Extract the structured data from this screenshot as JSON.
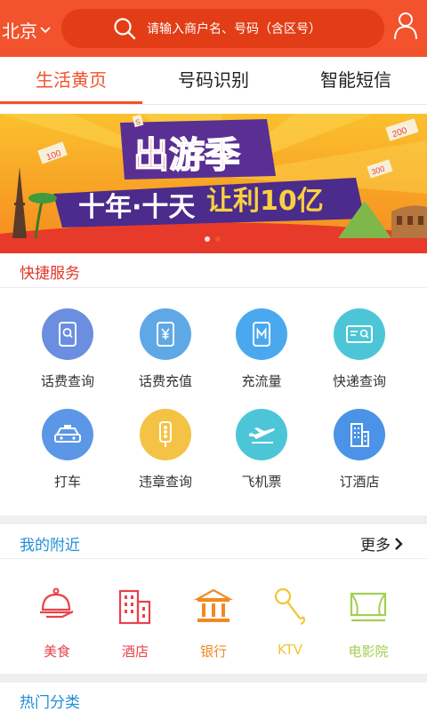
{
  "header": {
    "city": "北京",
    "search_placeholder": "请输入商户名、号码（含区号）"
  },
  "tabs": [
    {
      "label": "生活黄页",
      "active": true
    },
    {
      "label": "号码识别",
      "active": false
    },
    {
      "label": "智能短信",
      "active": false
    }
  ],
  "banner": {
    "title": "出游季",
    "line1": "十年·十天",
    "line2": "让利10亿",
    "tag_100": "100",
    "tag_200": "200",
    "tag_300": "300",
    "tag_s": "S",
    "slides": 2,
    "active_slide": 2
  },
  "quick": {
    "title": "快捷服务",
    "items": [
      {
        "label": "话费查询",
        "icon": "phone-search-icon",
        "color": "#6b8ee0"
      },
      {
        "label": "话费充值",
        "icon": "phone-yuan-icon",
        "color": "#5fa8e6"
      },
      {
        "label": "充流量",
        "icon": "phone-data-icon",
        "color": "#4aa9ee"
      },
      {
        "label": "快递查询",
        "icon": "package-search-icon",
        "color": "#4cc6d6"
      },
      {
        "label": "打车",
        "icon": "taxi-icon",
        "color": "#5b97e6"
      },
      {
        "label": "违章查询",
        "icon": "traffic-light-icon",
        "color": "#f4c245"
      },
      {
        "label": "飞机票",
        "icon": "airplane-icon",
        "color": "#4cc6d6"
      },
      {
        "label": "订酒店",
        "icon": "hotel-icon",
        "color": "#4a93e6"
      }
    ]
  },
  "nearby": {
    "title": "我的附近",
    "more": "更多",
    "items": [
      {
        "label": "美食",
        "icon": "food-dish-icon",
        "color": "#e8414a"
      },
      {
        "label": "酒店",
        "icon": "hotel-building-icon",
        "color": "#e8414a"
      },
      {
        "label": "银行",
        "icon": "bank-icon",
        "color": "#f08a20"
      },
      {
        "label": "KTV",
        "icon": "microphone-icon",
        "color": "#f2c531"
      },
      {
        "label": "电影院",
        "icon": "cinema-icon",
        "color": "#a3cf52"
      }
    ]
  },
  "hot": {
    "title": "热门分类"
  }
}
